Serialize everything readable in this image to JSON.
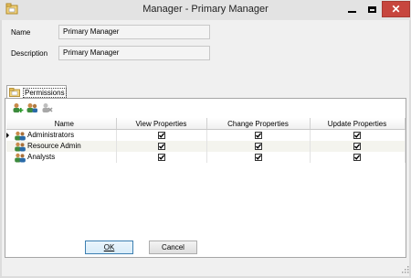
{
  "window": {
    "title": "Manager - Primary Manager",
    "close_glyph": "✕"
  },
  "form": {
    "name_label": "Name",
    "name_value": "Primary Manager",
    "description_label": "Description",
    "description_value": "Primary Manager"
  },
  "tabs": [
    {
      "label": "Permissions",
      "icon": "folder-icon",
      "selected": true
    }
  ],
  "toolbar": {
    "icons": [
      "add-user-icon",
      "edit-user-icon",
      "delete-user-icon"
    ]
  },
  "grid": {
    "columns": [
      "Name",
      "View Properties",
      "Change Properties",
      "Update Properties"
    ],
    "rows": [
      {
        "name": "Administrators",
        "view": true,
        "change": true,
        "update": true,
        "current": true
      },
      {
        "name": "Resource Admin",
        "view": true,
        "change": true,
        "update": true,
        "current": false
      },
      {
        "name": "Analysts",
        "view": true,
        "change": true,
        "update": true,
        "current": false
      }
    ]
  },
  "buttons": {
    "ok_label": "OK",
    "cancel_label": "Cancel"
  },
  "colors": {
    "close_button": "#c7463e",
    "alt_row": "#f4f4ee",
    "ok_border": "#3c7fb1"
  }
}
